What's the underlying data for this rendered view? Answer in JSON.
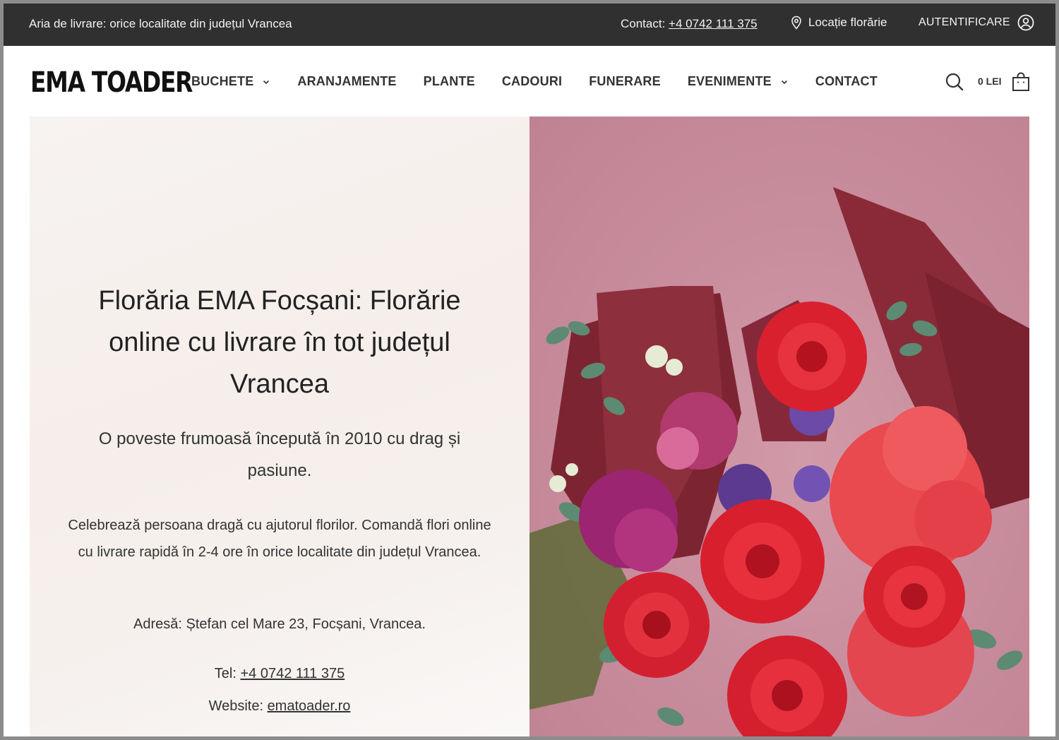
{
  "topbar": {
    "delivery": "Aria de livrare: orice localitate din județul Vrancea",
    "contact_label": "Contact: ",
    "contact_phone": "+4 0742 111 375",
    "location": "Locație florărie",
    "login": "AUTENTIFICARE"
  },
  "header": {
    "logo": "EMA TOADER",
    "nav": [
      {
        "label": "BUCHETE",
        "has_dropdown": true
      },
      {
        "label": "ARANJAMENTE",
        "has_dropdown": false
      },
      {
        "label": "PLANTE",
        "has_dropdown": false
      },
      {
        "label": "CADOURI",
        "has_dropdown": false
      },
      {
        "label": "FUNERARE",
        "has_dropdown": false
      },
      {
        "label": "EVENIMENTE",
        "has_dropdown": true
      },
      {
        "label": "CONTACT",
        "has_dropdown": false
      }
    ],
    "cart_total": "0 LEI"
  },
  "hero": {
    "title": "Florăria EMA Focșani: Florărie online cu livrare în tot județul Vrancea",
    "subtitle": "O poveste frumoasă începută în 2010 cu drag și pasiune.",
    "body": "Celebrează persoana dragă cu ajutorul florilor. Comandă flori online cu livrare rapidă în 2-4 ore în orice localitate din județul Vrancea.",
    "address": "Adresă: Ștefan cel Mare 23, Focșani, Vrancea.",
    "tel_label": "Tel: ",
    "tel": "+4 0742 111 375",
    "website_label": "Website: ",
    "website": "ematoader.ro"
  },
  "colors": {
    "topbar_bg": "#2f302f",
    "hero_pink": "#c98e9e",
    "rose_red": "#e0283a",
    "wrap_burgundy": "#7a2230"
  },
  "icons": [
    "pin-icon",
    "user-icon",
    "chevron-down-icon",
    "search-icon",
    "shopping-bag-icon"
  ]
}
